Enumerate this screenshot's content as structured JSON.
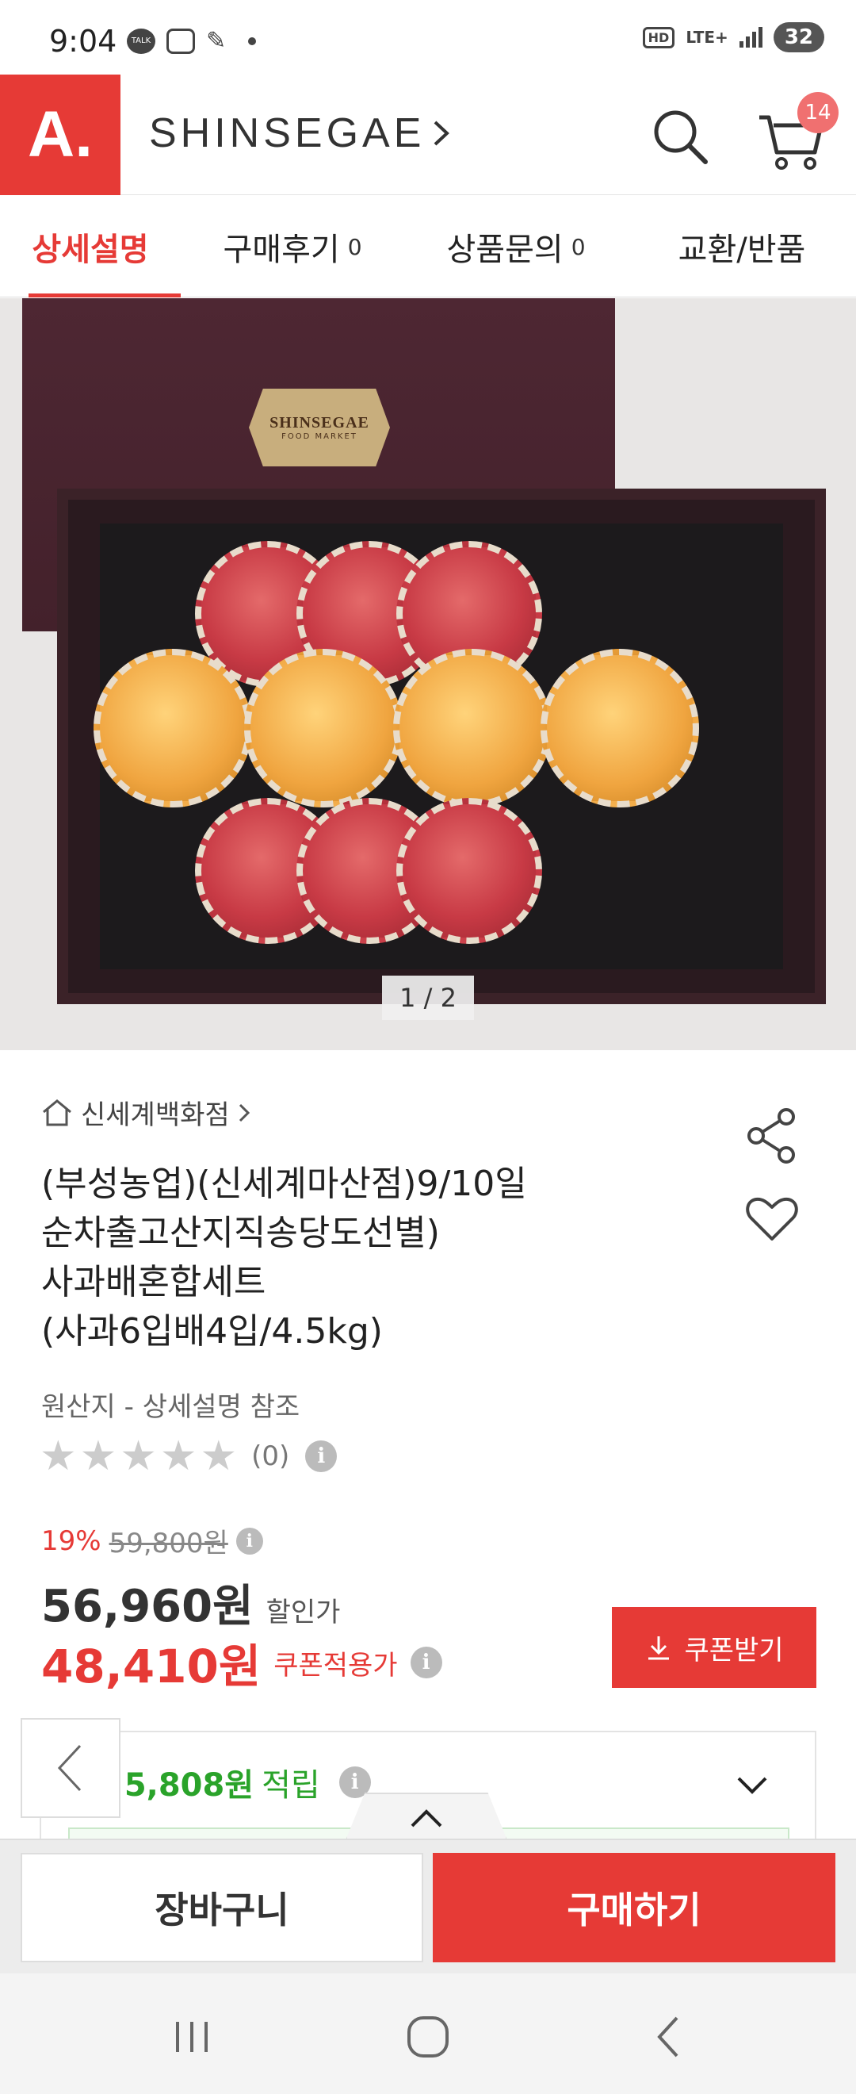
{
  "status": {
    "time": "9:04",
    "left_icons": [
      "talk-icon",
      "scan-icon",
      "feather-icon",
      "dot-icon"
    ],
    "hd": "HD",
    "lte": "LTE+",
    "battery": "32"
  },
  "header": {
    "logo_text": "A.",
    "brand": "SHINSEGAE",
    "cart_count": "14"
  },
  "tabs": [
    {
      "label": "상세설명",
      "count": "",
      "active": true
    },
    {
      "label": "구매후기",
      "count": "0",
      "active": false
    },
    {
      "label": "상품문의",
      "count": "0",
      "active": false
    },
    {
      "label": "교환/반품",
      "count": "",
      "active": false
    }
  ],
  "hero": {
    "lid_brand": "SHINSEGAE",
    "lid_sub": "FOOD MARKET",
    "pager": "1 / 2"
  },
  "product": {
    "store": "신세계백화점",
    "title_lines": [
      "(부성농업)(신세계마산점)9/10일",
      "순차출고산지직송당도선별)",
      "사과배혼합세트",
      "(사과6입배4입/4.5kg)"
    ],
    "origin": "원산지 - 상세설명 참조",
    "rating_stars": 0,
    "review_count": "(0)"
  },
  "price": {
    "discount_rate": "19%",
    "original": "59,800원",
    "sale": "56,960원",
    "sale_label": "할인가",
    "coupon_price": "48,410원",
    "coupon_label": "쿠폰적용가",
    "coupon_button": "쿠폰받기"
  },
  "points": {
    "prefix": "최",
    "amount": "5,808원",
    "suffix": "적립"
  },
  "actions": {
    "cart": "장바구니",
    "buy": "구매하기"
  },
  "colors": {
    "accent": "#e63a36",
    "points_green": "#2aa32a",
    "lid": "#4e2733"
  }
}
